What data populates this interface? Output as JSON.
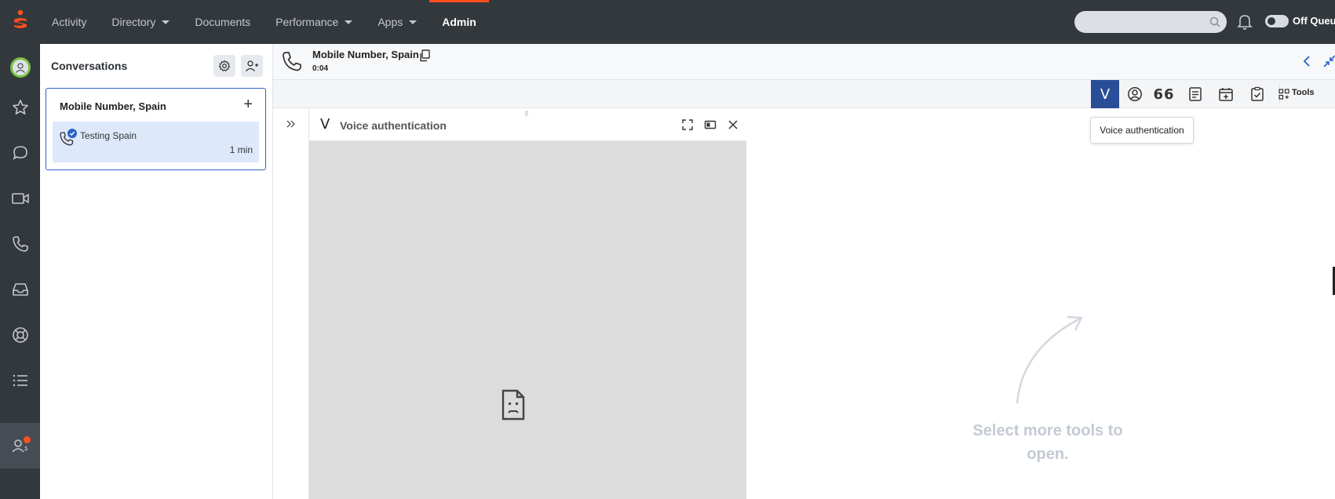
{
  "nav": {
    "items": [
      {
        "label": "Activity",
        "dropdown": false
      },
      {
        "label": "Directory",
        "dropdown": true
      },
      {
        "label": "Documents",
        "dropdown": false
      },
      {
        "label": "Performance",
        "dropdown": true
      },
      {
        "label": "Apps",
        "dropdown": true
      },
      {
        "label": "Admin",
        "dropdown": false,
        "active": true
      }
    ],
    "search_placeholder": "",
    "queue_label": "Off Queue"
  },
  "rail": {
    "icons": [
      "profile-avatar-icon",
      "star-icon",
      "chat-icon",
      "video-icon",
      "phone-icon",
      "inbox-icon",
      "lifebuoy-icon",
      "list-icon",
      "agent-status-icon"
    ]
  },
  "conversations": {
    "title": "Conversations",
    "card": {
      "title": "Mobile Number, Spain",
      "item_name": "Testing Spain",
      "item_time": "1 min"
    }
  },
  "interaction": {
    "title": "Mobile Number, Spain",
    "duration": "0:04"
  },
  "toolbar": {
    "tools_label": "Tools",
    "tooltip": "Voice authentication",
    "voice_glyph": "V",
    "quote_glyph": "66"
  },
  "voice_panel": {
    "logo_glyph": "V",
    "title": "Voice authentication"
  },
  "empty_state": {
    "line1": "Select more tools to",
    "line2": "open."
  },
  "colors": {
    "nav_bg": "#33383d",
    "accent_orange": "#ff4f1f",
    "active_tool": "#2a4d97",
    "selection_blue": "#dde9fb",
    "status_green": "#7bc043"
  }
}
